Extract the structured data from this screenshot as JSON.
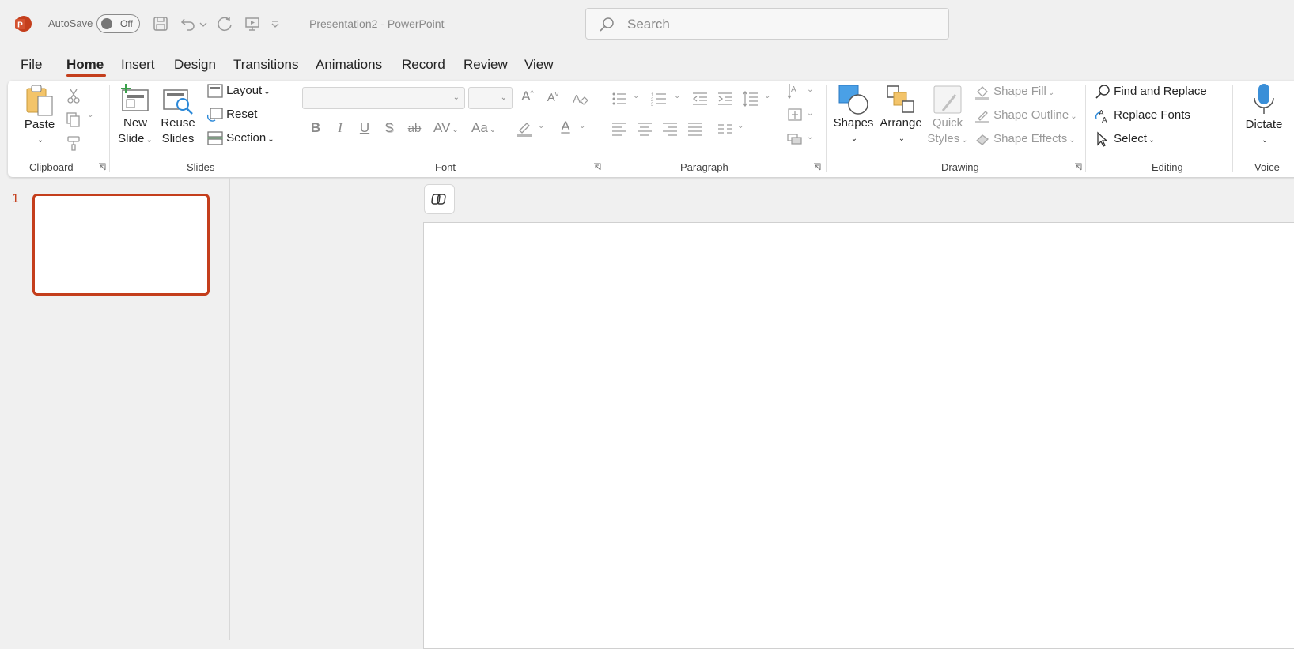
{
  "app": {
    "autosave_label": "AutoSave",
    "autosave_state": "Off",
    "document_title": "Presentation2",
    "app_name": "PowerPoint",
    "title_separator": " - ",
    "brand_color": "#c43e1c"
  },
  "search": {
    "placeholder": "Search"
  },
  "tabs": [
    {
      "label": "File"
    },
    {
      "label": "Home",
      "active": true
    },
    {
      "label": "Insert"
    },
    {
      "label": "Design"
    },
    {
      "label": "Transitions"
    },
    {
      "label": "Animations"
    },
    {
      "label": "Record"
    },
    {
      "label": "Review"
    },
    {
      "label": "View"
    }
  ],
  "ribbon": {
    "clipboard": {
      "label": "Clipboard",
      "paste": "Paste"
    },
    "slides": {
      "label": "Slides",
      "new_slide_1": "New",
      "new_slide_2": "Slide",
      "reuse_1": "Reuse",
      "reuse_2": "Slides",
      "layout": "Layout",
      "reset": "Reset",
      "section": "Section"
    },
    "font": {
      "label": "Font",
      "bold": "B",
      "italic": "I",
      "underline": "U",
      "shadow": "S",
      "strike": "ab",
      "spacing": "AV",
      "case": "Aa",
      "color": "A",
      "grow": "A",
      "shrink": "A"
    },
    "paragraph": {
      "label": "Paragraph"
    },
    "drawing": {
      "label": "Drawing",
      "shapes": "Shapes",
      "arrange": "Arrange",
      "quick_1": "Quick",
      "quick_2": "Styles",
      "shape_fill": "Shape Fill",
      "shape_outline": "Shape Outline",
      "shape_effects": "Shape Effects"
    },
    "editing": {
      "label": "Editing",
      "find_replace": "Find and Replace",
      "replace_fonts": "Replace Fonts",
      "select": "Select"
    },
    "voice": {
      "label": "Voice",
      "dictate": "Dictate"
    }
  },
  "slides_pane": {
    "slide_number": "1"
  }
}
